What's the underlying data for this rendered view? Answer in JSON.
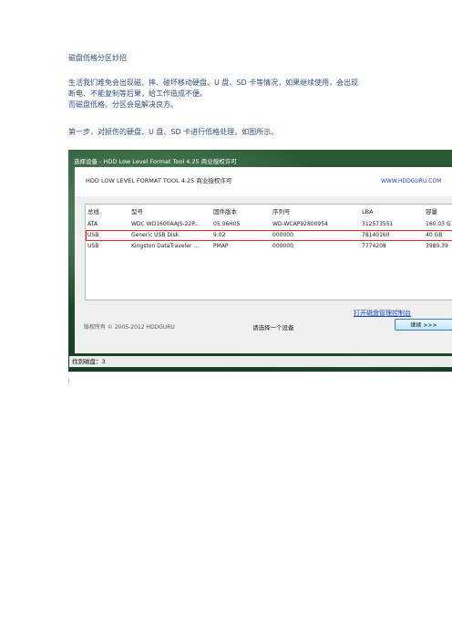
{
  "document": {
    "title": "磁盘低格分区妙招",
    "intro_lines": [
      "生活我们难免会出现磁、摔、碰坏移动硬盘、U 盘、SD 卡等情况，如果继续使用，会出现",
      "断电、不能复制等后果，给工作造成不便。",
      "而磁盘低格、分区会是解决良方。"
    ],
    "step1": "第一步，对损伤的硬盘、U 盘、SD 卡进行低格处理，如图所示。"
  },
  "screenshot": {
    "window_title": "选择设备 - HDD Low Level Format Tool 4.25  商业授权许可",
    "app_title": "HDD LOW LEVEL FORMAT TOOL 4.25  商业授权许可",
    "brand_link": "WWW.HDDGURU.COM",
    "table": {
      "headers": [
        "总线",
        "型号",
        "固件版本",
        "序列号",
        "LBA",
        "容量"
      ],
      "rows": [
        [
          "ATA",
          "WDC WD1600AAJS-22P...",
          "05.06H05",
          "WD-WCAP92800954",
          "312573551",
          "160.03 G"
        ],
        [
          "USB",
          "Generic USB Disk",
          "9.02",
          "000000",
          "78140160",
          "40 GB"
        ],
        [
          "USB",
          "Kingston DataTraveler ...",
          "PMAP",
          "000000",
          "7774208",
          "3980.39"
        ]
      ],
      "selected_row": 1
    },
    "copyright": "版权所有 © 2005-2012 HDDGURU",
    "prompt": "请选择一个设备",
    "console_link": "打开磁盘管理控制台",
    "continue_button": "继续 >>>",
    "status": "找到磁盘：3"
  },
  "colors": {
    "body_text": "#2f4f7f",
    "link": "#1a3fc8",
    "selection_outline": "#e0282e"
  }
}
